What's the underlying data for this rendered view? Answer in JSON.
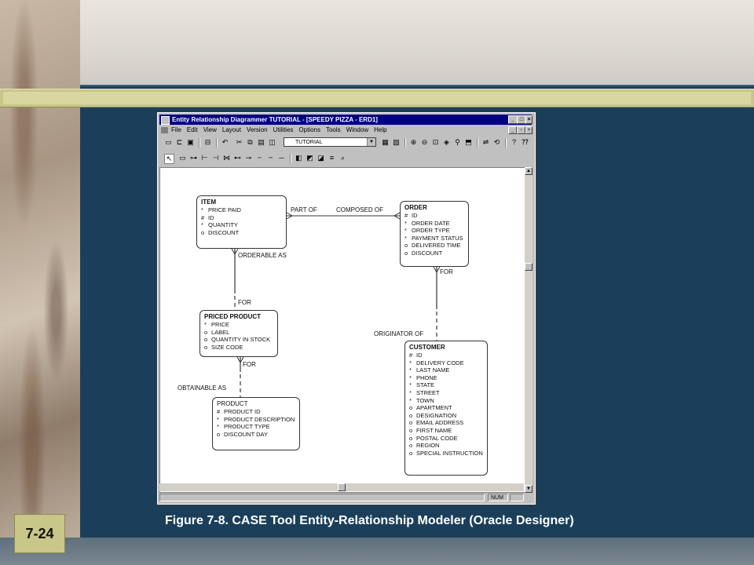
{
  "slide": {
    "page_number": "7-24",
    "caption": "Figure 7-8.  CASE Tool Entity-Relationship Modeler (Oracle Designer)"
  },
  "window": {
    "title": "Entity Relationship Diagrammer TUTORIAL - [SPEEDY PIZZA - ERD1]",
    "menu": [
      "File",
      "Edit",
      "View",
      "Layout",
      "Version",
      "Utilities",
      "Options",
      "Tools",
      "Window",
      "Help"
    ],
    "toolbar_combo_value": "TUTORIAL",
    "status_num": "NUM",
    "icons": [
      "new-icon",
      "open-icon",
      "save-icon",
      "print-icon",
      "undo-icon",
      "cut-icon",
      "copy-icon",
      "paste-icon",
      "combo-dropdown-icon",
      "zoom-in-icon",
      "zoom-out-icon",
      "select-arrow-icon",
      "entity-box-icon",
      "relationship-icon"
    ]
  },
  "diagram": {
    "entities": {
      "item": {
        "name": "ITEM",
        "attrs": [
          {
            "mark": "*",
            "text": "PRICE PAID"
          },
          {
            "mark": "#",
            "text": "ID"
          },
          {
            "mark": "*",
            "text": "QUANTITY"
          },
          {
            "mark": "o",
            "text": "DISCOUNT"
          }
        ]
      },
      "order": {
        "name": "ORDER",
        "attrs": [
          {
            "mark": "#",
            "text": "ID"
          },
          {
            "mark": "*",
            "text": "ORDER DATE"
          },
          {
            "mark": "*",
            "text": "ORDER TYPE"
          },
          {
            "mark": "*",
            "text": "PAYMENT STATUS"
          },
          {
            "mark": "o",
            "text": "DELIVERED TIME"
          },
          {
            "mark": "o",
            "text": "DISCOUNT"
          }
        ]
      },
      "priced_product": {
        "name": "PRICED PRODUCT",
        "attrs": [
          {
            "mark": "*",
            "text": "PRICE"
          },
          {
            "mark": "o",
            "text": "LABEL"
          },
          {
            "mark": "o",
            "text": "QUANTITY IN STOCK"
          },
          {
            "mark": "o",
            "text": "SIZE CODE"
          }
        ]
      },
      "customer": {
        "name": "CUSTOMER",
        "attrs": [
          {
            "mark": "#",
            "text": "ID"
          },
          {
            "mark": "*",
            "text": "DELIVERY CODE"
          },
          {
            "mark": "*",
            "text": "LAST NAME"
          },
          {
            "mark": "*",
            "text": "PHONE"
          },
          {
            "mark": "*",
            "text": "STATE"
          },
          {
            "mark": "*",
            "text": "STREET"
          },
          {
            "mark": "*",
            "text": "TOWN"
          },
          {
            "mark": "o",
            "text": "APARTMENT"
          },
          {
            "mark": "o",
            "text": "DESIGNATION"
          },
          {
            "mark": "o",
            "text": "EMAIL ADDRESS"
          },
          {
            "mark": "o",
            "text": "FIRST NAME"
          },
          {
            "mark": "o",
            "text": "POSTAL CODE"
          },
          {
            "mark": "o",
            "text": "REGION"
          },
          {
            "mark": "o",
            "text": "SPECIAL INSTRUCTION"
          }
        ]
      },
      "product": {
        "name": "PRODUCT",
        "attrs": [
          {
            "mark": "#",
            "text": "PRODUCT ID"
          },
          {
            "mark": "*",
            "text": "PRODUCT DESCRIPTION"
          },
          {
            "mark": "*",
            "text": "PRODUCT TYPE"
          },
          {
            "mark": "o",
            "text": "DISCOUNT DAY"
          }
        ]
      }
    },
    "relationship_labels": {
      "part_of": "PART OF",
      "composed_of": "COMPOSED OF",
      "orderable_as": "ORDERABLE AS",
      "for_item": "FOR",
      "for_order": "FOR",
      "originator_of": "ORIGINATOR OF",
      "for_priced": "FOR",
      "obtainable_as": "OBTAINABLE AS"
    }
  }
}
